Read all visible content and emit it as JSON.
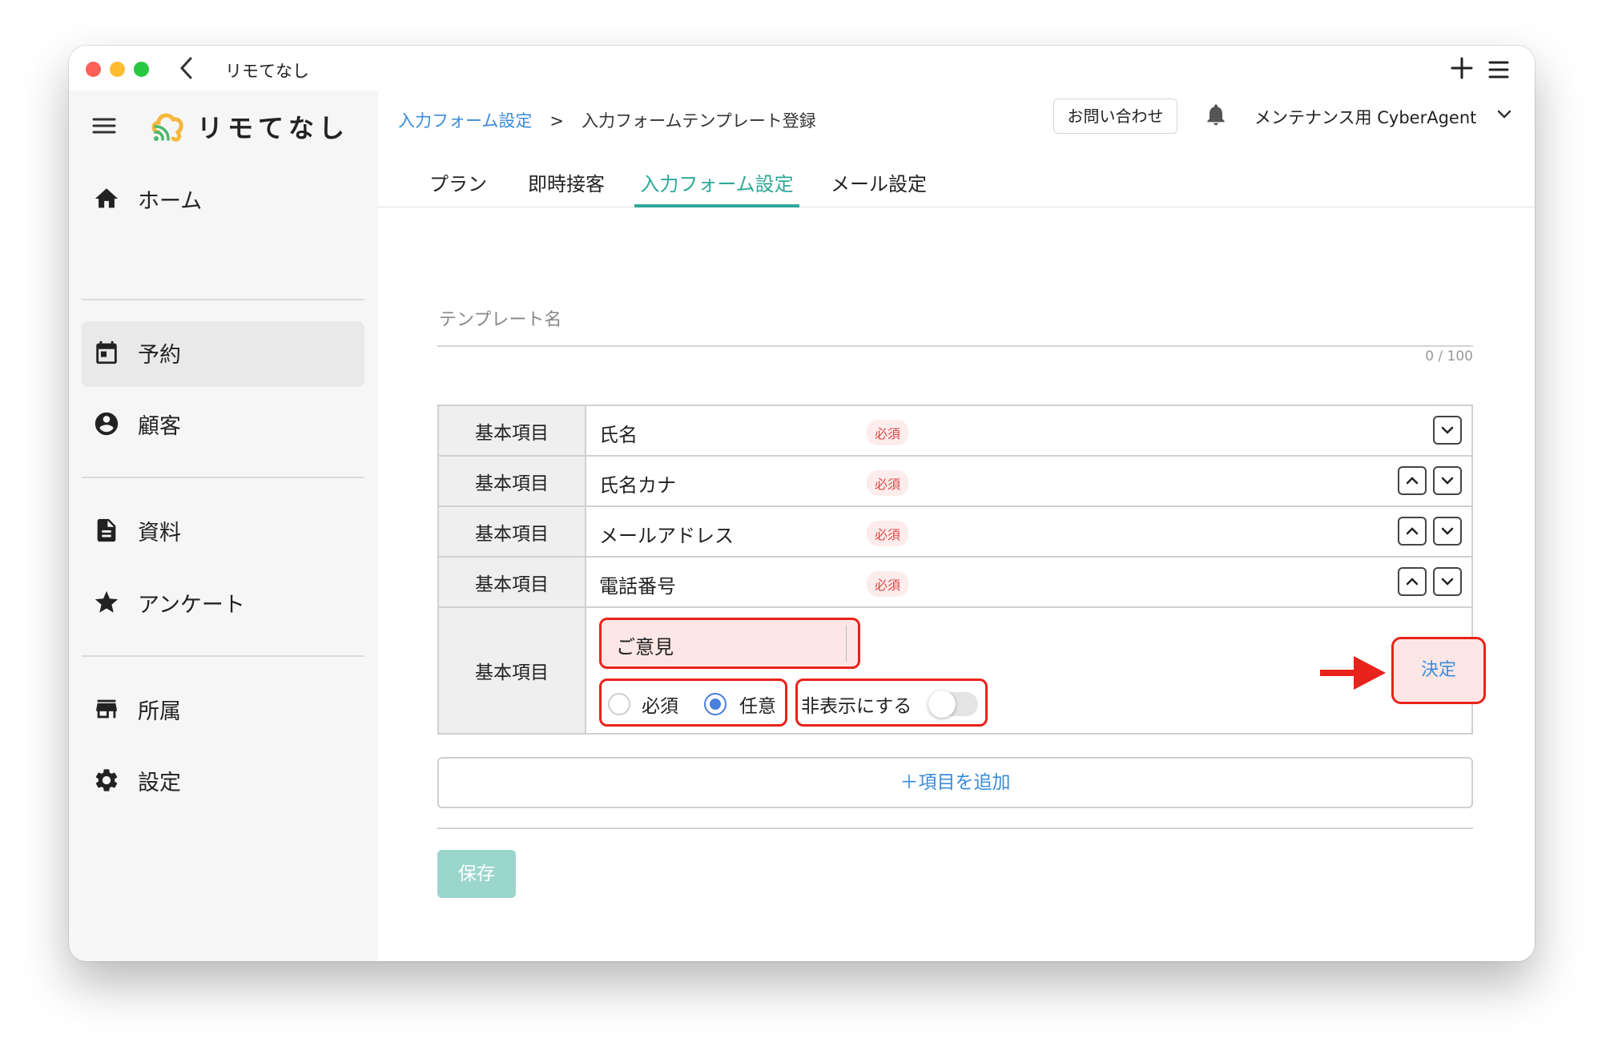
{
  "window": {
    "title": "リモてなし",
    "back_icon": "chevron-left-icon",
    "plus_icon": "plus-icon",
    "menu_icon": "menu-icon"
  },
  "sidebar": {
    "brand": "リモてなし",
    "items": [
      {
        "label": "ホーム",
        "icon": "home-icon"
      },
      {
        "label": "予約",
        "icon": "calendar-icon",
        "active": true
      },
      {
        "label": "顧客",
        "icon": "account-circle-icon"
      },
      {
        "label": "資料",
        "icon": "document-icon"
      },
      {
        "label": "アンケート",
        "icon": "star-icon"
      },
      {
        "label": "所属",
        "icon": "store-icon"
      },
      {
        "label": "設定",
        "icon": "gear-icon"
      }
    ]
  },
  "header": {
    "breadcrumb": {
      "parent": "入力フォーム設定",
      "separator": ">",
      "current": "入力フォームテンプレート登録"
    },
    "contact_label": "お問い合わせ",
    "user_name": "メンテナンス用 CyberAgent"
  },
  "tabs": [
    {
      "label": "プラン"
    },
    {
      "label": "即時接客"
    },
    {
      "label": "入力フォーム設定",
      "active": true
    },
    {
      "label": "メール設定"
    }
  ],
  "form": {
    "template_name_placeholder": "テンプレート名",
    "counter": "0 / 100",
    "rows": [
      {
        "category": "基本項目",
        "name": "氏名",
        "badge": "必須"
      },
      {
        "category": "基本項目",
        "name": "氏名カナ",
        "badge": "必須"
      },
      {
        "category": "基本項目",
        "name": "メールアドレス",
        "badge": "必須"
      },
      {
        "category": "基本項目",
        "name": "電話番号",
        "badge": "必須"
      }
    ],
    "edit_row": {
      "category": "基本項目",
      "input_value": "ご意見",
      "radio_required": "必須",
      "radio_optional": "任意",
      "selected": "任意",
      "hide_label": "非表示にする",
      "hide_enabled": false,
      "decide_label": "決定"
    },
    "add_label": "＋項目を追加",
    "save_label": "保存"
  },
  "colors": {
    "accent": "#2fa89a",
    "link": "#3b8bd9",
    "highlight": "#e8231b",
    "required": "#e04545"
  }
}
